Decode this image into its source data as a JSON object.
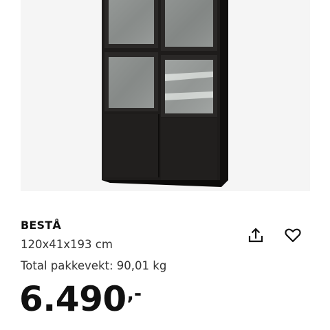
{
  "product": {
    "name": "BESTÅ",
    "description": "120x41x193 cm",
    "weight": "Total pakkevekt: 90,01 kg",
    "price": "6.490",
    "price_suffix": ",-"
  },
  "icons": {
    "share": "share-icon",
    "favorite": "heart-icon"
  },
  "colors": {
    "image_background": "#f5f5f5",
    "cabinet": "#1b1918",
    "glass": "#8d918e",
    "text": "#111111"
  }
}
